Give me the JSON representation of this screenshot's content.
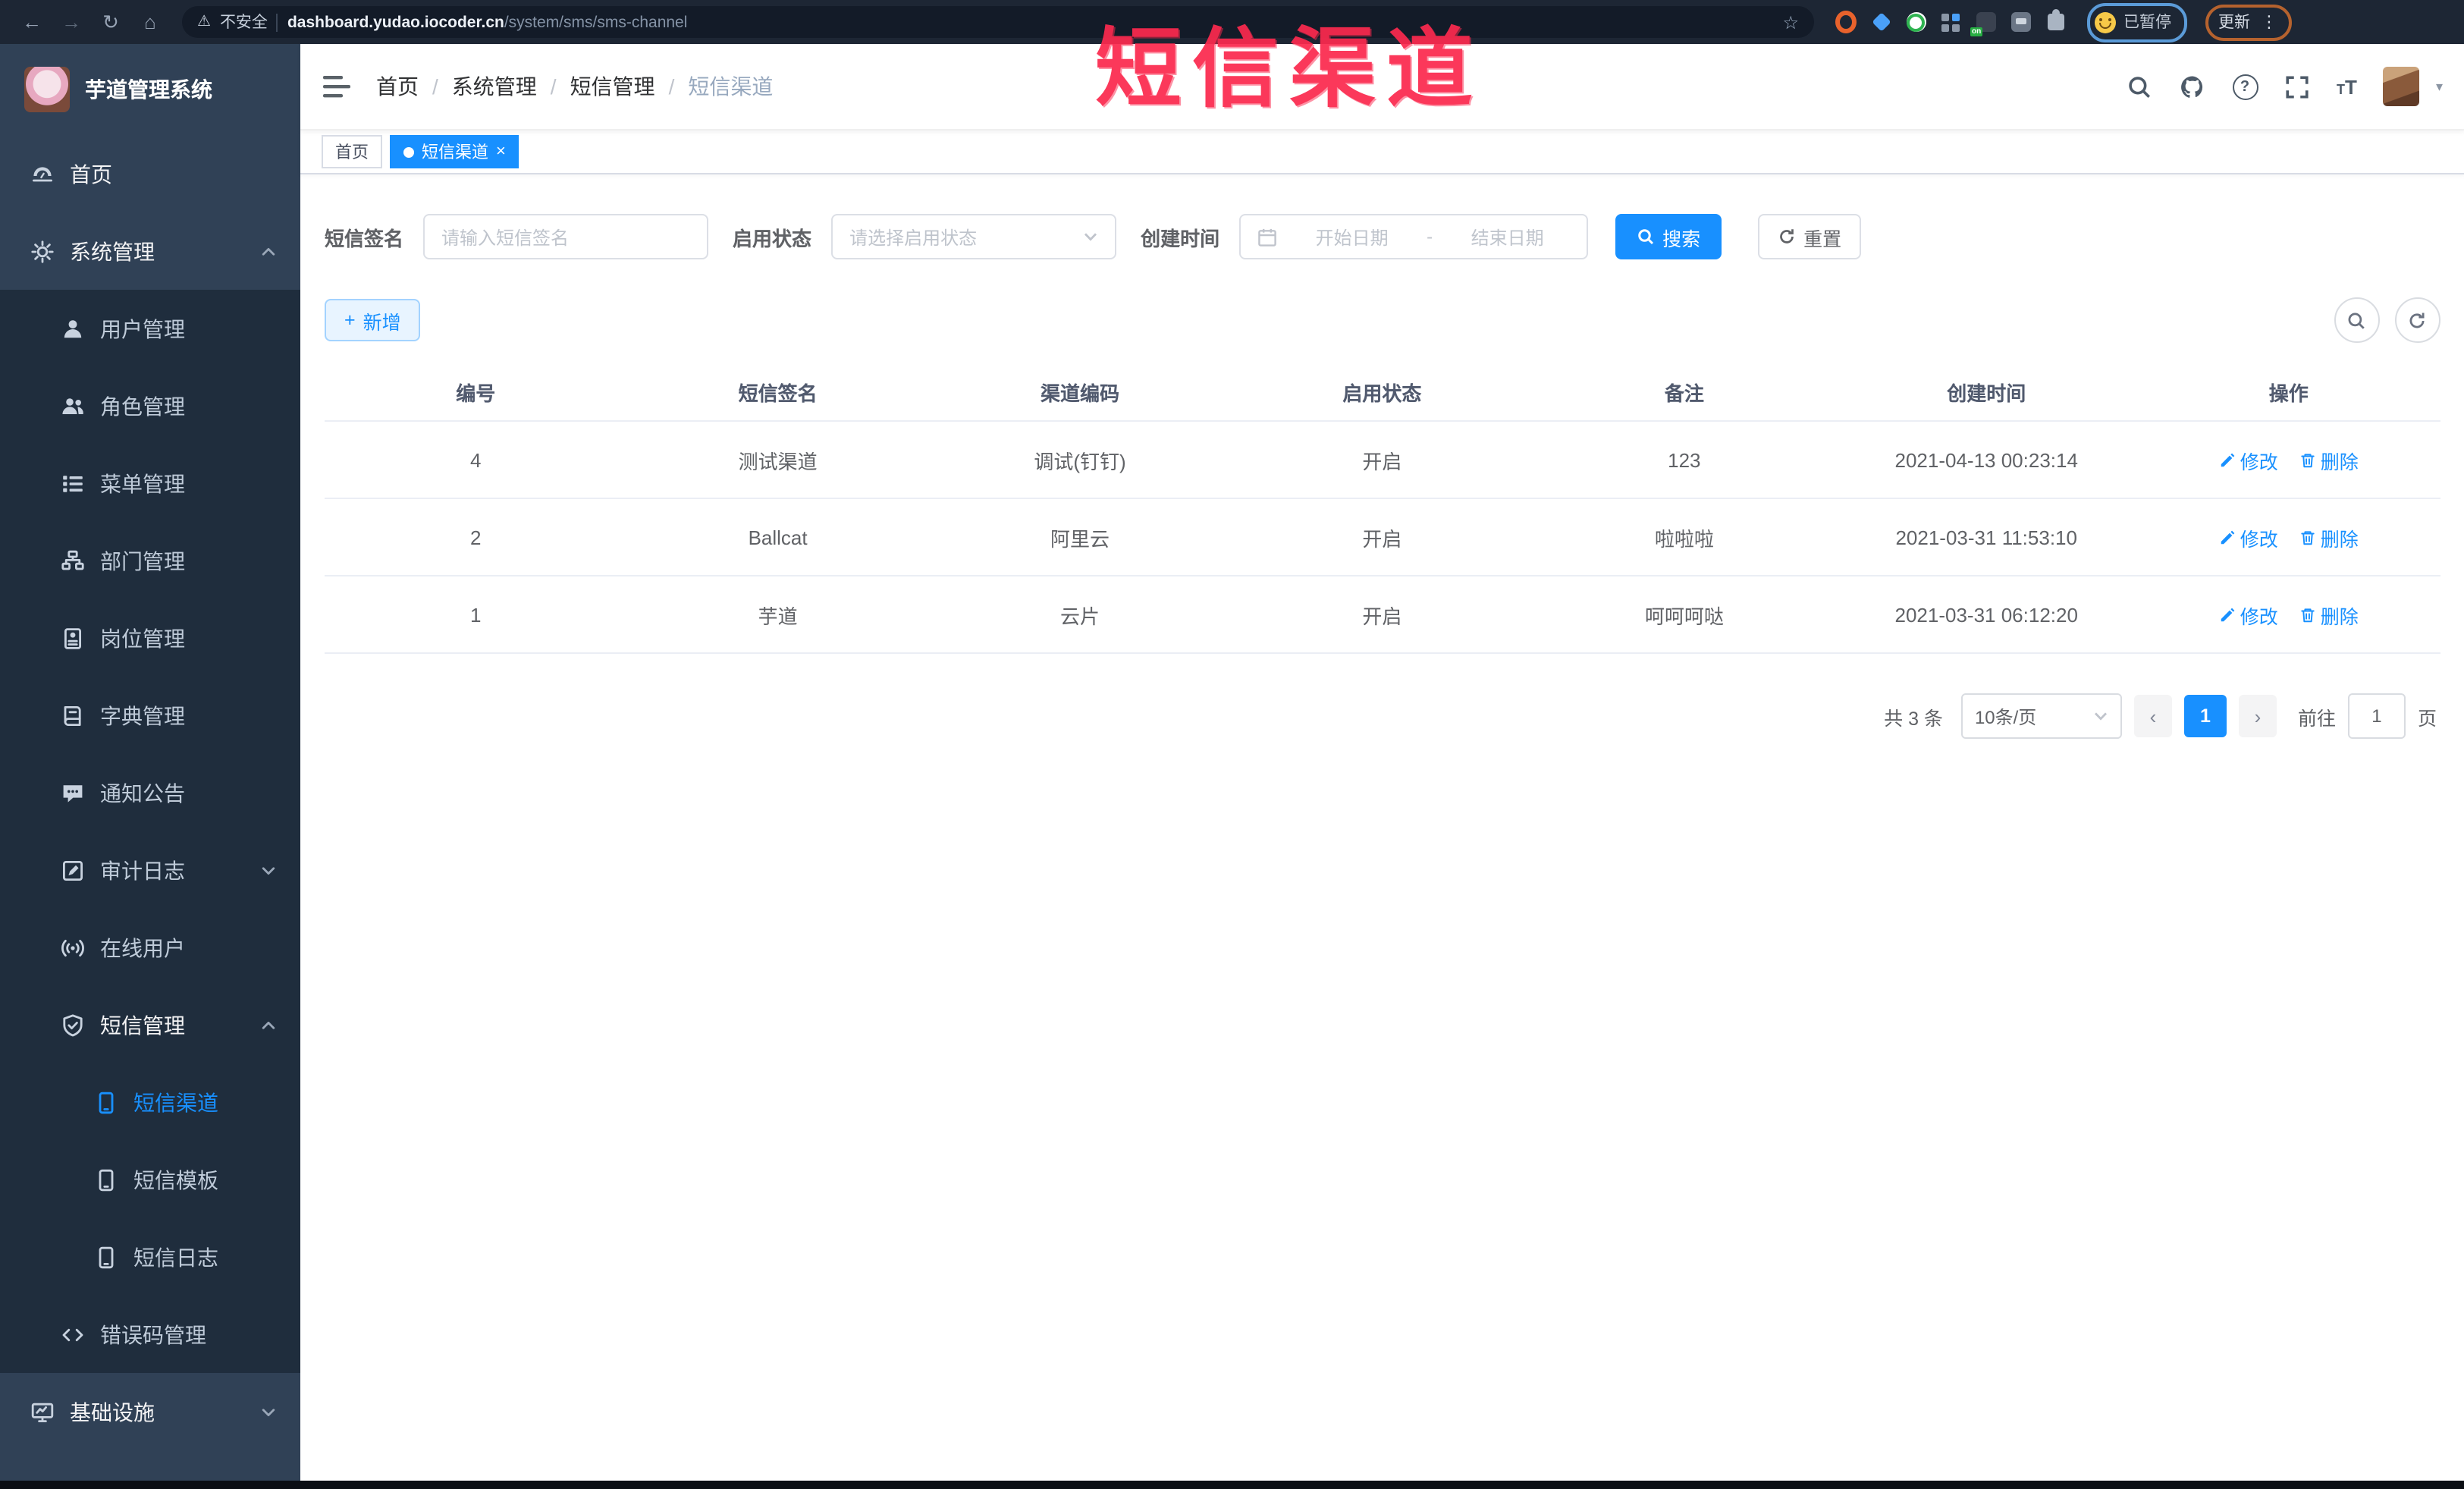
{
  "watermark": "短信渠道",
  "browser": {
    "security_label": "不安全",
    "url_host": "dashboard.yudao.iocoder.cn",
    "url_path": "/system/sms/sms-channel",
    "ext_badge": "on",
    "paused_label": "已暂停",
    "update_label": "更新"
  },
  "sidebar": {
    "logo_title": "芋道管理系统",
    "items": [
      {
        "label": "首页",
        "icon": "dashboard-icon",
        "level": 1,
        "light": true
      },
      {
        "label": "系统管理",
        "icon": "gear-icon",
        "level": 1,
        "light": true,
        "caret": "up"
      },
      {
        "label": "用户管理",
        "icon": "user-icon",
        "level": 2
      },
      {
        "label": "角色管理",
        "icon": "role-icon",
        "level": 2
      },
      {
        "label": "菜单管理",
        "icon": "menu-list-icon",
        "level": 2
      },
      {
        "label": "部门管理",
        "icon": "org-tree-icon",
        "level": 2
      },
      {
        "label": "岗位管理",
        "icon": "post-badge-icon",
        "level": 2
      },
      {
        "label": "字典管理",
        "icon": "dict-book-icon",
        "level": 2
      },
      {
        "label": "通知公告",
        "icon": "notice-icon",
        "level": 2
      },
      {
        "label": "审计日志",
        "icon": "audit-log-icon",
        "level": 2,
        "caret": "down"
      },
      {
        "label": "在线用户",
        "icon": "online-user-icon",
        "level": 2
      },
      {
        "label": "短信管理",
        "icon": "sms-shield-icon",
        "level": 2,
        "caret": "up",
        "parent": true
      },
      {
        "label": "短信渠道",
        "icon": "phone-icon",
        "level": 3,
        "active": true
      },
      {
        "label": "短信模板",
        "icon": "phone-icon",
        "level": 3
      },
      {
        "label": "短信日志",
        "icon": "phone-icon",
        "level": 3
      },
      {
        "label": "错误码管理",
        "icon": "code-icon",
        "level": 2
      },
      {
        "label": "基础设施",
        "icon": "monitor-icon",
        "level": 1,
        "light": true,
        "caret": "down"
      }
    ]
  },
  "header": {
    "breadcrumb": [
      "首页",
      "系统管理",
      "短信管理",
      "短信渠道"
    ]
  },
  "tabs": [
    {
      "label": "首页",
      "active": false,
      "closable": false
    },
    {
      "label": "短信渠道",
      "active": true,
      "closable": true
    }
  ],
  "filters": {
    "signature_label": "短信签名",
    "signature_placeholder": "请输入短信签名",
    "status_label": "启用状态",
    "status_placeholder": "请选择启用状态",
    "time_label": "创建时间",
    "start_placeholder": "开始日期",
    "range_separator": "-",
    "end_placeholder": "结束日期",
    "search_label": "搜索",
    "reset_label": "重置"
  },
  "toolbar": {
    "add_label": "新增"
  },
  "table": {
    "headers": [
      "编号",
      "短信签名",
      "渠道编码",
      "启用状态",
      "备注",
      "创建时间",
      "操作"
    ],
    "edit_label": "修改",
    "delete_label": "删除",
    "rows": [
      {
        "id": "4",
        "signature": "测试渠道",
        "code": "调试(钉钉)",
        "status": "开启",
        "remark": "123",
        "created": "2021-04-13 00:23:14"
      },
      {
        "id": "2",
        "signature": "Ballcat",
        "code": "阿里云",
        "status": "开启",
        "remark": "啦啦啦",
        "created": "2021-03-31 11:53:10"
      },
      {
        "id": "1",
        "signature": "芋道",
        "code": "云片",
        "status": "开启",
        "remark": "呵呵呵哒",
        "created": "2021-03-31 06:12:20"
      }
    ]
  },
  "pagination": {
    "total_label": "共 3 条",
    "page_size": "10条/页",
    "current_page": "1",
    "goto_label": "前往",
    "goto_value": "1",
    "page_unit": "页"
  },
  "colors": {
    "primary": "#1890ff",
    "sidebar_bg": "#304156",
    "submenu_bg": "#1f2d3d",
    "watermark_red": "#fb2a4e",
    "chrome_bg": "#1d2634"
  }
}
